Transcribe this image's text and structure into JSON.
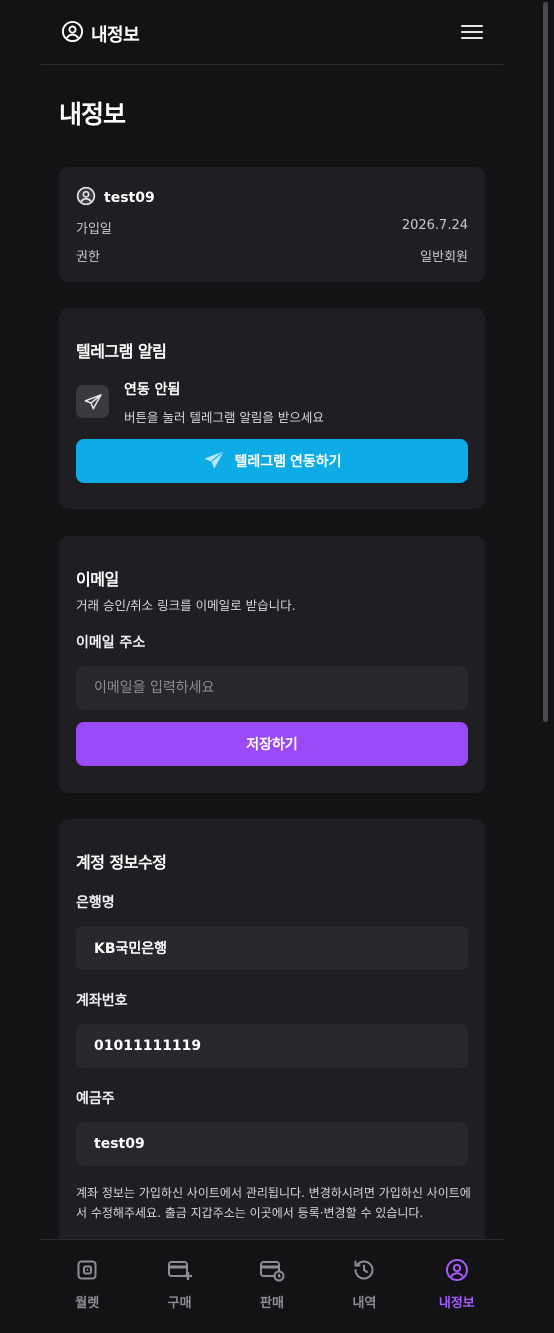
{
  "header": {
    "title": "내정보",
    "menu_icon": "hamburger-menu-icon"
  },
  "page": {
    "title": "내정보"
  },
  "profile": {
    "username": "test09",
    "rows": [
      {
        "label": "가입일",
        "value": "2026.7.24"
      },
      {
        "label": "권한",
        "value": "일반회원"
      }
    ]
  },
  "telegram": {
    "heading": "텔레그램 알림",
    "status_title": "연동 안됨",
    "status_desc": "버튼을 눌러 텔레그램 알림을 받으세요",
    "button_label": "텔레그램 연동하기"
  },
  "email": {
    "heading": "이메일",
    "description": "거래 승인/취소 링크를 이메일로 받습니다.",
    "field_label": "이메일 주소",
    "placeholder": "이메일을 입력하세요",
    "value": "",
    "save_label": "저장하기"
  },
  "account": {
    "heading": "계정 정보수정",
    "bank_label": "은행명",
    "bank_value": "KB국민은행",
    "account_label": "계좌번호",
    "account_value": "01011111119",
    "holder_label": "예금주",
    "holder_value": "test09",
    "note": "계좌 정보는 가입하신 사이트에서 관리됩니다. 변경하시려면 가입하신 사이트에서 수정해주세요. 출금 지갑주소는 이곳에서 등록·변경할 수 있습니다."
  },
  "nav": {
    "items": [
      {
        "label": "월렛",
        "icon": "wallet-icon"
      },
      {
        "label": "구매",
        "icon": "buy-icon"
      },
      {
        "label": "판매",
        "icon": "sell-icon"
      },
      {
        "label": "내역",
        "icon": "history-icon"
      },
      {
        "label": "내정보",
        "icon": "profile-icon",
        "active": true
      }
    ]
  },
  "colors": {
    "background": "#131215",
    "card": "#1f1e23",
    "input": "#28272d",
    "accent_purple": "#9a4bf7",
    "telegram_blue": "#0eace6",
    "nav_active": "#a55bff"
  }
}
